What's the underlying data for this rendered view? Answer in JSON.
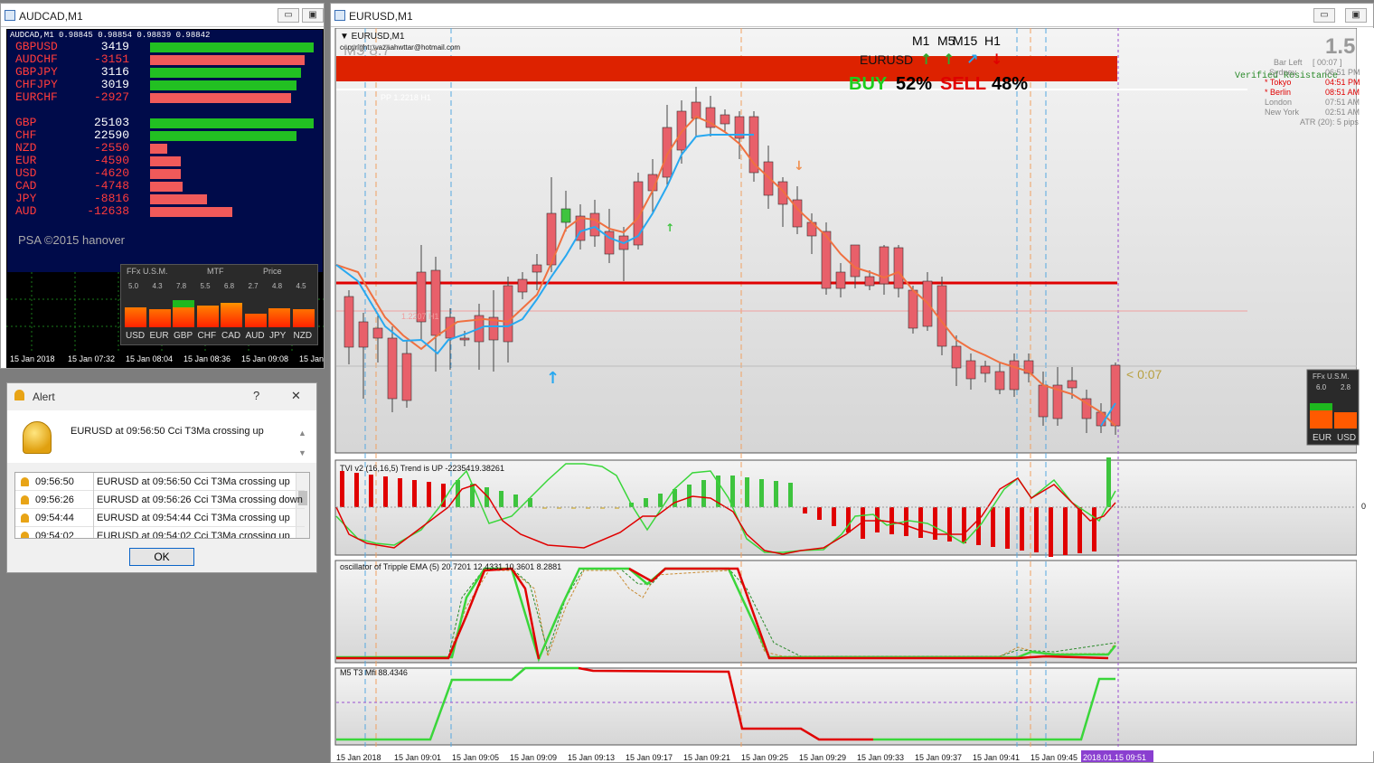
{
  "left_window": {
    "title": "AUDCAD,M1",
    "chart_header": "AUDCAD,M1  0.98845 0.98854 0.98839 0.98842",
    "pairs": [
      {
        "name": "GBPUSD",
        "value": "3419",
        "level": 0.95,
        "color": "#22c022"
      },
      {
        "name": "AUDCHF",
        "value": "-3151",
        "level": 0.9,
        "color": "#f05a5a"
      },
      {
        "name": "GBPJPY",
        "value": "3116",
        "level": 0.88,
        "color": "#22c022"
      },
      {
        "name": "CHFJPY",
        "value": "3019",
        "level": 0.85,
        "color": "#22c022"
      },
      {
        "name": "EURCHF",
        "value": "-2927",
        "level": 0.82,
        "color": "#f05a5a"
      }
    ],
    "currencies": [
      {
        "name": "GBP",
        "value": "25103",
        "level": 0.95,
        "color": "#22c022"
      },
      {
        "name": "CHF",
        "value": "22590",
        "level": 0.85,
        "color": "#22c022"
      },
      {
        "name": "NZD",
        "value": "-2550",
        "level": 0.1,
        "color": "#f05a5a"
      },
      {
        "name": "EUR",
        "value": "-4590",
        "level": 0.18,
        "color": "#f05a5a"
      },
      {
        "name": "USD",
        "value": "-4620",
        "level": 0.18,
        "color": "#f05a5a"
      },
      {
        "name": "CAD",
        "value": "-4748",
        "level": 0.19,
        "color": "#f05a5a"
      },
      {
        "name": "JPY",
        "value": "-8816",
        "level": 0.33,
        "color": "#f05a5a"
      },
      {
        "name": "AUD",
        "value": "-12638",
        "level": 0.48,
        "color": "#f05a5a"
      }
    ],
    "copyright": "PSA ©2015 hanover",
    "ffx_panel": {
      "header_left": "FFx U.S.M.",
      "header_mid": "MTF",
      "header_right": "Price",
      "values": [
        "5.0",
        "4.3",
        "7.8",
        "5.5",
        "6.8",
        "2.7",
        "4.8",
        "4.5"
      ],
      "currencies": [
        "USD",
        "EUR",
        "GBP",
        "CHF",
        "CAD",
        "AUD",
        "JPY",
        "NZD"
      ]
    },
    "time_axis": [
      "15 Jan 2018",
      "15 Jan 07:32",
      "15 Jan 08:04",
      "15 Jan 08:36",
      "15 Jan 09:08",
      "15 Jan"
    ]
  },
  "alert": {
    "title": "Alert",
    "help": "?",
    "close": "✕",
    "message": "EURUSD at 09:56:50 Cci T3Ma crossing up",
    "log": [
      {
        "time": "09:56:50",
        "msg": "EURUSD at 09:56:50 Cci T3Ma crossing up"
      },
      {
        "time": "09:56:26",
        "msg": "EURUSD at 09:56:26 Cci T3Ma crossing down"
      },
      {
        "time": "09:54:44",
        "msg": "EURUSD at 09:54:44 Cci T3Ma crossing up"
      },
      {
        "time": "09:54:02",
        "msg": "EURUSD at 09:54:02 Cci T3Ma crossing up"
      }
    ],
    "ok": "OK"
  },
  "main_window": {
    "title": "EURUSD,M1",
    "chart_label": "EURUSD,M1",
    "copyright": "copyright: wazaahwttar@hotmail.com",
    "watermark": "M5 8.7",
    "symbol": "EURUSD",
    "timeframes": [
      "M1",
      "M5",
      "M15",
      "H1"
    ],
    "buy_label": "BUY",
    "buy_pct": "52%",
    "sell_label": "SELL",
    "sell_pct": "48%",
    "pp_label": "PP 1.2218 H1",
    "s1_label": "1.2207 H1",
    "countdown": "< 0:07",
    "big_number": "1.5",
    "bar_left_label": "Bar Left",
    "bar_left_value": "[ 00:07 ]",
    "verified": "Verified Resistance",
    "sessions": [
      {
        "city": "Sydney",
        "time": "06:51 PM",
        "active": false
      },
      {
        "city": "* Tokyo",
        "time": "04:51 PM",
        "active": true
      },
      {
        "city": "* Berlin",
        "time": "08:51 AM",
        "active": true
      },
      {
        "city": "London",
        "time": "07:51 AM",
        "active": false
      },
      {
        "city": "New York",
        "time": "02:51 AM",
        "active": false
      }
    ],
    "atr": "ATR (20): 5 pips",
    "mini_ffx": {
      "header": "FFx U.S.M.",
      "v1": "6.0",
      "v2": "2.8",
      "c1": "EUR",
      "c2": "USD"
    },
    "tvi_label": "TVI v2 (16,16,5) Trend is UP -2235419.38261",
    "osc_label": "oscillator of Tripple EMA (5) 20.7201 12.4331 10.3601 8.2881",
    "mfi_label": "M5  T3 Mfi  88.4346",
    "right_scale_tvi": "0",
    "time_axis": [
      "15 Jan 2018",
      "15 Jan 09:01",
      "15 Jan 09:05",
      "15 Jan 09:09",
      "15 Jan 09:13",
      "15 Jan 09:17",
      "15 Jan 09:21",
      "15 Jan 09:25",
      "15 Jan 09:29",
      "15 Jan 09:33",
      "15 Jan 09:37",
      "15 Jan 09:41",
      "15 Jan 09:45"
    ],
    "current_time": "2018.01.15 09:51"
  },
  "colors": {
    "bull": "#3ec43e",
    "bear": "#e8606a",
    "resistance": "#dd2200",
    "support_line": "#e00000"
  }
}
